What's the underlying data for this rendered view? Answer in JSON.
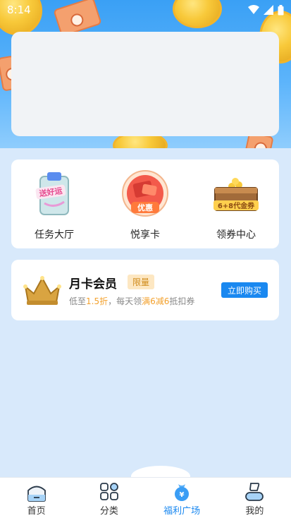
{
  "status_bar": {
    "time": "8:14"
  },
  "features": [
    {
      "label": "任务大厅",
      "icon": "task-hall-icon",
      "icon_text": "送好运"
    },
    {
      "label": "悦享卡",
      "icon": "discount-card-icon",
      "icon_text": "优惠"
    },
    {
      "label": "领券中心",
      "icon": "coupon-center-icon",
      "icon_text": "6+8代金券"
    }
  ],
  "membership": {
    "title": "月卡会员",
    "badge": "限量",
    "desc_prefix": "低至",
    "discount": "1.5折",
    "desc_mid": "，每天领",
    "deal": "满6减6",
    "desc_suffix": "抵扣券",
    "button": "立即购买"
  },
  "bottom_nav": [
    {
      "label": "首页",
      "icon": "home-icon",
      "active": false
    },
    {
      "label": "分类",
      "icon": "category-icon",
      "active": false
    },
    {
      "label": "福利广场",
      "icon": "welfare-bag-icon",
      "active": true
    },
    {
      "label": "我的",
      "icon": "profile-icon",
      "active": false
    }
  ],
  "colors": {
    "accent": "#1a88f0",
    "highlight": "#f3a02b",
    "page_bg": "#d8e9fb"
  }
}
